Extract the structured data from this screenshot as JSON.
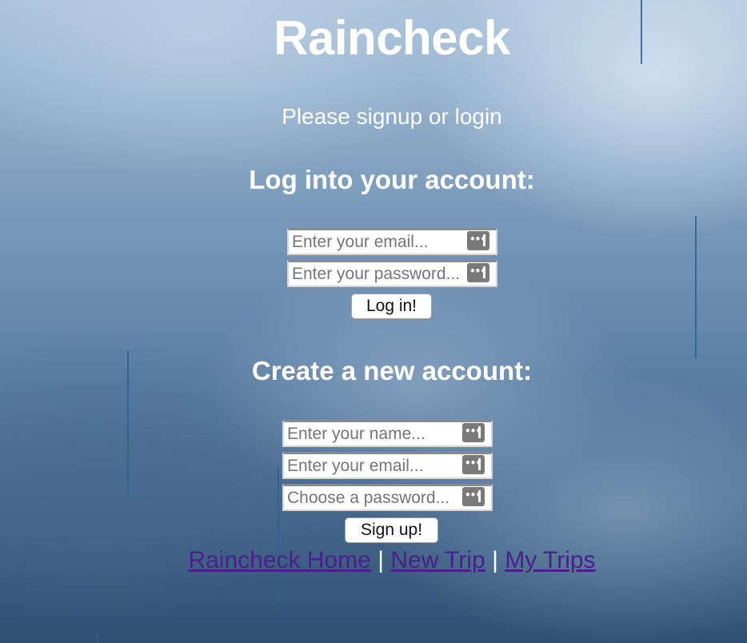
{
  "header": {
    "title": "Raincheck",
    "subtitle": "Please signup or login"
  },
  "login": {
    "heading": "Log into your account:",
    "email_placeholder": "Enter your email...",
    "password_placeholder": "Enter your password...",
    "button_label": "Log in!"
  },
  "signup": {
    "heading": "Create a new account:",
    "name_placeholder": "Enter your name...",
    "email_placeholder": "Enter your email...",
    "password_placeholder": "Choose a password...",
    "button_label": "Sign up!"
  },
  "footer": {
    "links": [
      "Raincheck Home",
      "New Trip",
      "My Trips"
    ],
    "separator": "|"
  },
  "colors": {
    "text": "#ffffff",
    "link_visited": "#4a1f8c",
    "rain_streak": "#2e5f94"
  },
  "icons": {
    "field_icon": "password-manager-key-icon"
  }
}
